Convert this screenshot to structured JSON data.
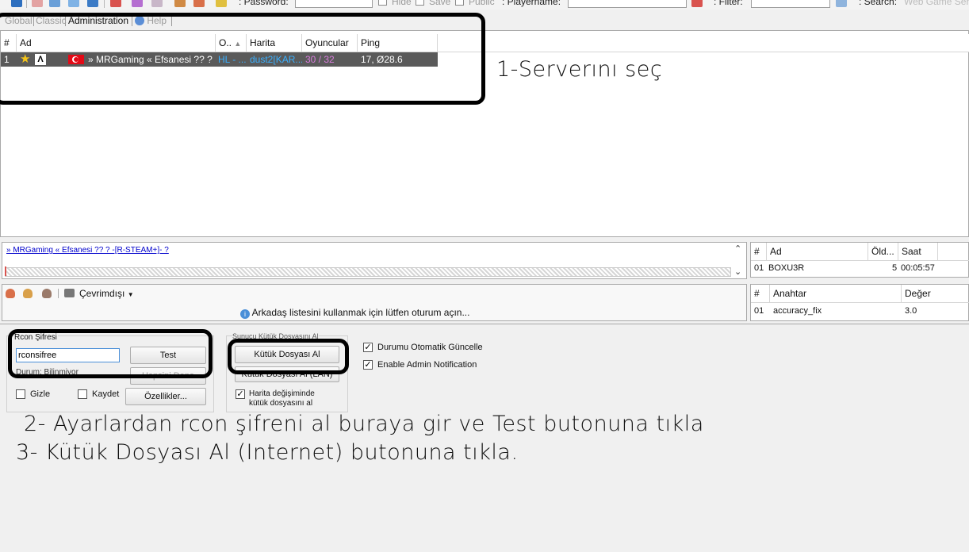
{
  "toolbar": {
    "password_label": ": Password:",
    "hide_label": "Hide",
    "save_label": "Save",
    "public_label": "Public",
    "playername_label": ": Playername:",
    "filter_label": ": Filter:",
    "search_label": ": Search:",
    "search_placeholder": "Web Game Serv"
  },
  "tabs": [
    "Global",
    "Classic",
    "Administration",
    "Help"
  ],
  "server_list": {
    "columns": [
      "#",
      "Ad",
      "O..",
      "Harita",
      "Oyuncular",
      "Ping"
    ],
    "rows": [
      {
        "index": "1",
        "name": "» MRGaming « Efsanesi ?? ? ...",
        "game": "HL - ...",
        "map": "dust2[KAR...",
        "players": "30 / 32",
        "ping": "17, Ø28.6"
      }
    ]
  },
  "server_info_link": "» MRGaming « Efsanesi ?? ? -[R-STEAM+]- ?",
  "players_table": {
    "columns": [
      "#",
      "Ad",
      "Öld...",
      "Saat"
    ],
    "rows": [
      {
        "index": "01",
        "name": "BOXU3R",
        "kills": "5",
        "time": "00:05:57"
      }
    ]
  },
  "friends": {
    "status_label": "Çevrimdışı",
    "message": "Arkadaş listesini kullanmak için lütfen oturum açın..."
  },
  "rules_table": {
    "columns": [
      "#",
      "Anahtar",
      "Değer"
    ],
    "rows": [
      {
        "index": "01",
        "key": "accuracy_fix",
        "value": "3.0"
      }
    ]
  },
  "rcon": {
    "group_label": "Rcon Şifresi",
    "password_value": "rconsifree",
    "test_button": "Test",
    "status_text": "Durum: Bilinmiyor",
    "hidden_button": "Hepsini Dene",
    "hide_label": "Gizle",
    "save_label": "Kaydet",
    "properties_button": "Özellikler..."
  },
  "log": {
    "group_label": "Sunucu Kütük Dosyasını Al",
    "get_internet_button": "Kütük Dosyası Al (Internet)",
    "get_lan_button": "Kütük Dosyası Al (LAN)",
    "map_change_label_1": "Harita değişiminde",
    "map_change_label_2": "kütük dosyasını al"
  },
  "options": {
    "auto_update_label": "Durumu Otomatik Güncelle",
    "admin_notify_label": "Enable Admin Notification"
  },
  "annotations": {
    "step1": "1-Serverını seç",
    "step2": "2- Ayarlardan rcon şifreni al buraya gir ve Test butonuna tıkla",
    "step3": "3- Kütük Dosyası Al (Internet) butonuna tıkla."
  },
  "colors": {
    "row_selected_bg": "#5a5a5a",
    "game_text": "#3ab0ff",
    "map_text": "#3ab0ff",
    "players_text": "#d87bdc",
    "link_blue": "#0000cc"
  }
}
